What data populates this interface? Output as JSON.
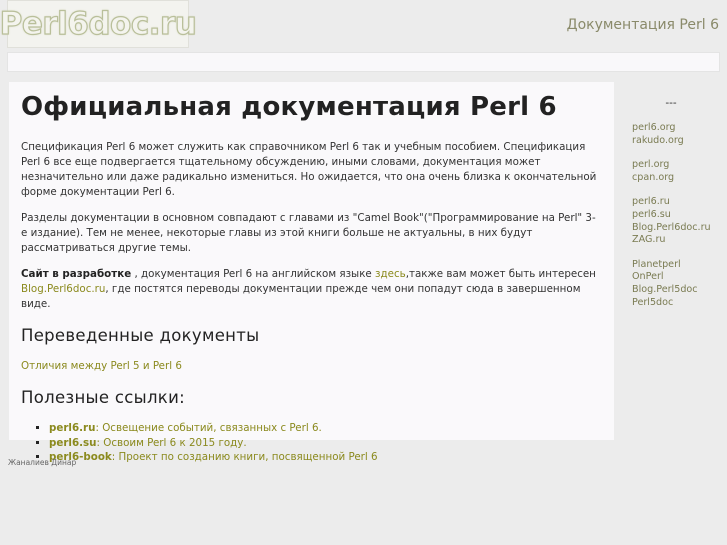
{
  "header": {
    "logo_text": "Perl6doc.ru",
    "site_title": "Документация Perl 6"
  },
  "main": {
    "title": "Официальная документация Perl 6",
    "intro": "Спецификация Perl 6 может служить как справочником Perl 6 так и учебным пособием. Спецификация Perl 6 все еще подвергается тщательному обсуждению, иными словами, документация может незначительно или даже радикально измениться. Но ожидается, что она очень близка к окончательной форме документации Perl 6.",
    "sections_text": "Разделы документации в основном совпадают с главами из \"Camel Book\"(\"Программирование на Perl\" 3-е издание). Тем не менее, некоторые главы из этой книги больше не актуальны, в них будут рассматриваться другие темы.",
    "dev_bold": "Сайт в разработке",
    "dev_text1": " , документация Perl 6 на английском языке ",
    "dev_link_here": "здесь",
    "dev_text2": ",также вам может быть интересен ",
    "dev_link_blog": "Blog.Perl6doc.ru",
    "dev_text3": ", где постятся переводы документации прежде чем они попадут сюда в завершенном виде.",
    "translated_heading": "Переведенные документы",
    "translated_link": "Отличия между Perl 5 и Perl 6",
    "useful_heading": "Полезные ссылки:",
    "useful_links": [
      {
        "key": "perl6.ru",
        "text": ": Освещение событий, связанных с Perl 6."
      },
      {
        "key": "perl6.su",
        "text": ": Освоим Perl 6 к 2015 году."
      },
      {
        "key": "perl6-book",
        "text": ": Проект по созданию книги, посвященной Perl 6"
      }
    ]
  },
  "sidebar": {
    "title": "---",
    "groups": [
      [
        "perl6.org",
        "rakudo.org"
      ],
      [
        "perl.org",
        "cpan.org"
      ],
      [
        "perl6.ru",
        "perl6.su",
        "Blog.Perl6doc.ru",
        "ZAG.ru"
      ],
      [
        "Planetperl",
        "OnPerl",
        "Blog.Perl5doc",
        "Perl5doc"
      ]
    ]
  },
  "footer": {
    "author": "Жаналиев Динар"
  }
}
